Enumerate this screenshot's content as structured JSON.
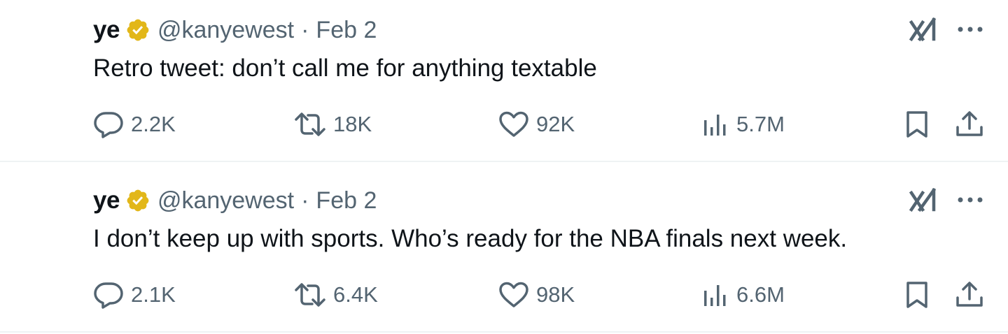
{
  "colors": {
    "text_primary": "#0f1419",
    "text_secondary": "#536471",
    "divider": "#eff3f4",
    "verified_badge": "#e2b719"
  },
  "tweets": [
    {
      "name": "ye",
      "handle": "@kanyewest",
      "separator": "·",
      "date": "Feb 2",
      "text": "Retro tweet: don’t call me for anything textable",
      "replies": "2.2K",
      "retweets": "18K",
      "likes": "92K",
      "views": "5.7M"
    },
    {
      "name": "ye",
      "handle": "@kanyewest",
      "separator": "·",
      "date": "Feb 2",
      "text": "I don’t keep up with sports. Who’s ready for the NBA finals next week.",
      "replies": "2.1K",
      "retweets": "6.4K",
      "likes": "98K",
      "views": "6.6M"
    }
  ],
  "icons": {
    "verified": "verified-badge-icon",
    "grok": "grok-icon",
    "more": "more-icon",
    "reply": "reply-icon",
    "retweet": "retweet-icon",
    "like": "heart-icon",
    "views": "views-icon",
    "bookmark": "bookmark-icon",
    "share": "share-icon"
  }
}
